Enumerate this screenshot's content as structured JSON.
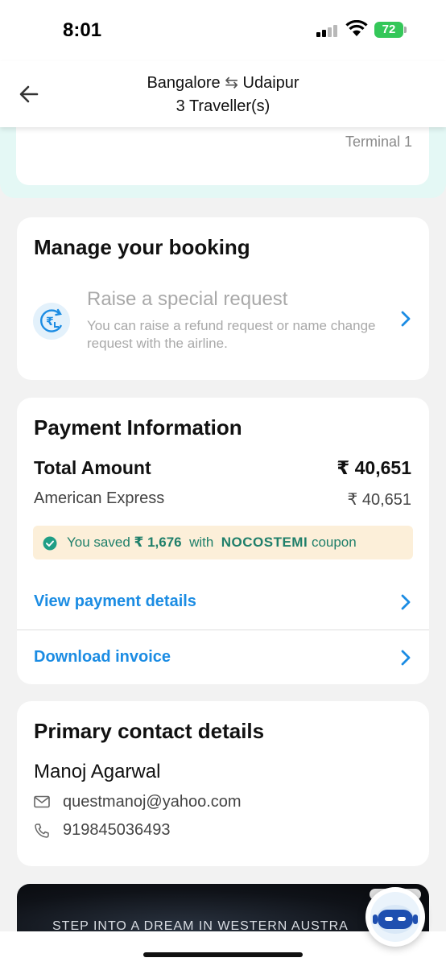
{
  "status_bar": {
    "time": "8:01",
    "battery": "72"
  },
  "header": {
    "route_from": "Bangalore",
    "route_swap_symbol": "⇆",
    "route_to": "Udaipur",
    "travellers": "3 Traveller(s)"
  },
  "flight_card": {
    "terminal": "Terminal 1"
  },
  "manage_booking": {
    "title": "Manage your booking",
    "request_title": "Raise a special request",
    "request_desc": "You can raise a refund request or name change request with the airline."
  },
  "payment": {
    "title": "Payment Information",
    "total_label": "Total Amount",
    "total_value": "₹ 40,651",
    "card_label": "American Express",
    "card_value": "₹ 40,651",
    "saved_prefix": "You saved",
    "saved_amount": "₹ 1,676",
    "saved_with": "with",
    "coupon_code": "NOCOSTEMI",
    "saved_suffix": "coupon",
    "view_details": "View payment details",
    "download_invoice": "Download invoice"
  },
  "contact": {
    "title": "Primary contact details",
    "name": "Manoj Agarwal",
    "email": "questmanoj@yahoo.com",
    "phone": "919845036493"
  },
  "promo": {
    "text": "STEP INTO A DREAM IN WESTERN AUSTRA"
  },
  "colors": {
    "link_blue": "#1b8ce3",
    "saved_green": "#1f7f6a",
    "saved_bg": "#fcefd9",
    "mint_bg": "#e4f8f5"
  }
}
